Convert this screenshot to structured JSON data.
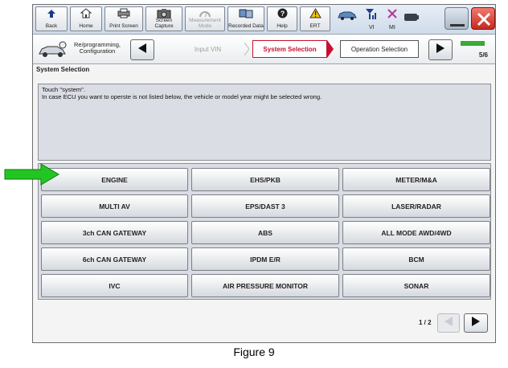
{
  "toolbar": {
    "buttons": [
      {
        "label": "Back",
        "icon": "back-arrow-icon"
      },
      {
        "label": "Home",
        "icon": "home-icon"
      },
      {
        "label": "Print Screen",
        "icon": "printer-icon"
      },
      {
        "label": "Screen Capture",
        "icon": "camera-icon"
      },
      {
        "label": "Measurement Mode",
        "icon": "meter-icon"
      },
      {
        "label": "Recorded Data",
        "icon": "recorded-data-icon"
      },
      {
        "label": "Help",
        "icon": "help-icon"
      },
      {
        "label": "ERT",
        "icon": "warning-icon"
      }
    ],
    "vi_label": "VI",
    "mi_label": "MI"
  },
  "nav": {
    "reprog_label": "Re/programming, Configuration",
    "steps": [
      "Input VIN",
      "System Selection",
      "Operation Selection"
    ],
    "progress": "5/6",
    "progress_fraction": 0.83
  },
  "page": {
    "section_title": "System Selection",
    "message_line1": "Touch \"system\".",
    "message_line2": "In case ECU you want to operste is not listed below, the vehicle or model year might be selected wrong."
  },
  "systems": [
    [
      "ENGINE",
      "EHS/PKB",
      "METER/M&A"
    ],
    [
      "MULTI AV",
      "EPS/DAST 3",
      "LASER/RADAR"
    ],
    [
      "3ch CAN GATEWAY",
      "ABS",
      "ALL MODE AWD/4WD"
    ],
    [
      "6ch CAN GATEWAY",
      "IPDM E/R",
      "BCM"
    ],
    [
      "IVC",
      "AIR PRESSURE MONITOR",
      "SONAR"
    ]
  ],
  "pager": {
    "text": "1 / 2"
  },
  "caption": "Figure 9",
  "colors": {
    "accent_red": "#c8102e",
    "arrow_green": "#22c622",
    "progress_green": "#3aa935",
    "close_red": "#e0443c"
  }
}
